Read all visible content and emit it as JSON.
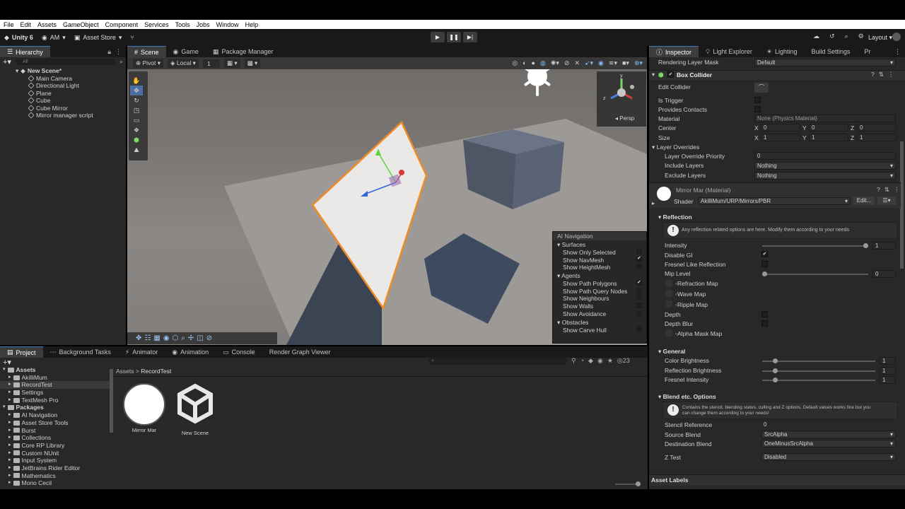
{
  "menu": [
    "File",
    "Edit",
    "Assets",
    "GameObject",
    "Component",
    "Services",
    "Tools",
    "Jobs",
    "Window",
    "Help"
  ],
  "toolbar": {
    "unity_label": "Unity 6",
    "account": "AM",
    "asset_store": "Asset Store",
    "layout": "Layout"
  },
  "hierarchy": {
    "tab": "Hierarchy",
    "search_placeholder": "All",
    "scene": "New Scene*",
    "items": [
      "Main Camera",
      "Directional Light",
      "Plane",
      "Cube",
      "Cube Mirror",
      "Mirror manager script"
    ]
  },
  "scene_tabs": [
    "Scene",
    "Game",
    "Package Manager"
  ],
  "scene_toolbar": {
    "pivot": "Pivot",
    "local": "Local",
    "grid": "1"
  },
  "gizmo": {
    "label": "Persp",
    "y": "y",
    "z": "z"
  },
  "ai_overlay": {
    "title": "AI Navigation",
    "surfaces_head": "Surfaces",
    "surfaces": [
      {
        "label": "Show Only Selected",
        "checked": false
      },
      {
        "label": "Show NavMesh",
        "checked": true
      },
      {
        "label": "Show HeightMesh",
        "checked": false
      }
    ],
    "agents_head": "Agents",
    "agents": [
      {
        "label": "Show Path Polygons",
        "checked": true
      },
      {
        "label": "Show Path Query Nodes",
        "checked": false
      },
      {
        "label": "Show Neighbours",
        "checked": false
      },
      {
        "label": "Show Walls",
        "checked": false
      },
      {
        "label": "Show Avoidance",
        "checked": false
      }
    ],
    "obstacles_head": "Obstacles",
    "obstacles": [
      {
        "label": "Show Carve Hull",
        "checked": false
      }
    ]
  },
  "bottom_tabs": [
    "Project",
    "Background Tasks",
    "Animator",
    "Animation",
    "Console",
    "Render Graph Viewer"
  ],
  "project": {
    "tree": [
      {
        "label": "Assets",
        "level": 0,
        "bold": true
      },
      {
        "label": "AkilliMum",
        "level": 1
      },
      {
        "label": "RecordTest",
        "level": 1,
        "selected": true
      },
      {
        "label": "Settings",
        "level": 1
      },
      {
        "label": "TextMesh Pro",
        "level": 1
      },
      {
        "label": "Packages",
        "level": 0,
        "bold": true
      },
      {
        "label": "AI Navigation",
        "level": 1
      },
      {
        "label": "Asset Store Tools",
        "level": 1
      },
      {
        "label": "Burst",
        "level": 1
      },
      {
        "label": "Collections",
        "level": 1
      },
      {
        "label": "Core RP Library",
        "level": 1
      },
      {
        "label": "Custom NUnit",
        "level": 1
      },
      {
        "label": "Input System",
        "level": 1
      },
      {
        "label": "JetBrains Rider Editor",
        "level": 1
      },
      {
        "label": "Mathematics",
        "level": 1
      },
      {
        "label": "Mono Cecil",
        "level": 1
      }
    ],
    "breadcrumb_root": "Assets",
    "breadcrumb_leaf": "RecordTest",
    "badge_count": "23",
    "assets": [
      "Mirror Mar",
      "New Scene"
    ]
  },
  "inspector": {
    "tabs": [
      "Inspector",
      "Light Explorer",
      "Lighting",
      "Build Settings",
      "Pr"
    ],
    "rendering_layer_mask": {
      "label": "Rendering Layer Mask",
      "value": "Default"
    },
    "box_collider": "Box Collider",
    "edit_collider": "Edit Collider",
    "is_trigger": "Is Trigger",
    "provides_contacts": "Provides Contacts",
    "material": {
      "label": "Material",
      "value": "None (Physics Material)"
    },
    "center": {
      "label": "Center",
      "x": "0",
      "y": "0",
      "z": "0"
    },
    "size": {
      "label": "Size",
      "x": "1",
      "y": "1",
      "z": "1"
    },
    "axes": [
      "X",
      "Y",
      "Z"
    ],
    "layer_overrides": "Layer Overrides",
    "layer_override_priority": {
      "label": "Layer Override Priority",
      "value": "0"
    },
    "include_layers": {
      "label": "Include Layers",
      "value": "Nothing"
    },
    "exclude_layers": {
      "label": "Exclude Layers",
      "value": "Nothing"
    },
    "material_name": "Mirror Mar (Material)",
    "shader": {
      "label": "Shader",
      "value": "AkilliMum/URP/Mirrors/PBR",
      "edit": "Edit..."
    },
    "reflection": "Reflection",
    "reflection_note": "Any reflection related options are here. Modify them according to your needs",
    "intensity": {
      "label": "Intensity",
      "value": "1",
      "fraction": 1
    },
    "disable_gi": {
      "label": "Disable GI",
      "checked": true
    },
    "fresnel_like": {
      "label": "Fresnel Like Reflection",
      "checked": false
    },
    "mip_level": {
      "label": "Mip Level",
      "value": "0",
      "fraction": 0
    },
    "refraction_map": "Refraction Map",
    "wave_map": "Wave Map",
    "ripple_map": "Ripple Map",
    "depth": "Depth",
    "depth_blur": "Depth Blur",
    "alpha_mask_map": "Alpha Mask Map",
    "general": "General",
    "color_brightness": {
      "label": "Color Brightness",
      "value": "1",
      "fraction": 0.1
    },
    "reflection_brightness": {
      "label": "Reflection Brightness",
      "value": "1",
      "fraction": 0.1
    },
    "fresnel_intensity": {
      "label": "Fresnel Intensity",
      "value": "1",
      "fraction": 0.1
    },
    "blend_options": "Blend etc. Options",
    "blend_note_1": "Contains the stencil, blending states, culling and Z options. Default values works fine but you",
    "blend_note_2": "can change them according to your needs!",
    "stencil_reference": {
      "label": "Stencil Reference",
      "value": "0"
    },
    "source_blend": {
      "label": "Source Blend",
      "value": "SrcAlpha"
    },
    "destination_blend": {
      "label": "Destination Blend",
      "value": "OneMinusSrcAlpha"
    },
    "z_test": {
      "label": "Z Test",
      "value": "Disabled"
    },
    "asset_labels": "Asset Labels"
  },
  "colors": {
    "accent": "#3a79bb",
    "selection_outline": "#f08a24"
  }
}
